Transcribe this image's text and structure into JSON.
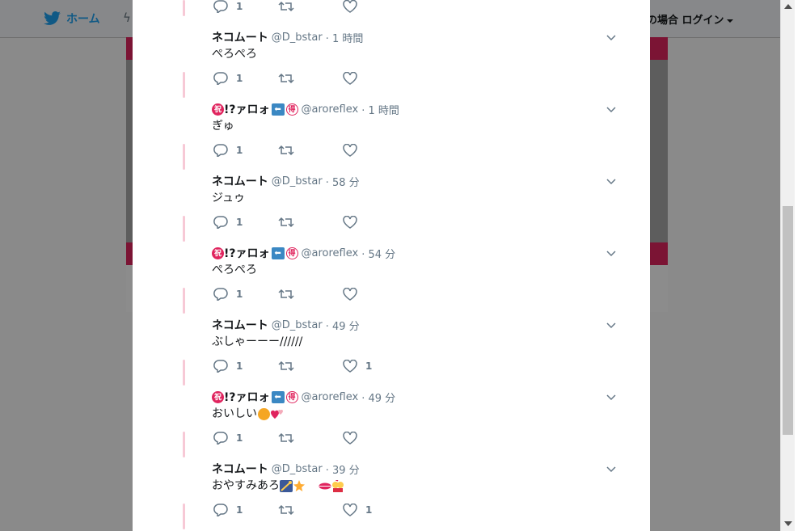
{
  "nav": {
    "home_label": "ホーム",
    "login_prefix": "の場合",
    "login_label": "ログイン"
  },
  "colors": {
    "accent": "#1da1f2",
    "brand_pink": "#e0245e",
    "thread_line": "#f7c9d6"
  },
  "top_actions": {
    "reply_count": "1"
  },
  "tweets": [
    {
      "name": "ネコムート",
      "handle": "@D_bstar",
      "time": "· 1 時間",
      "text": "ぺろぺろ",
      "reply_count": "1",
      "like_count": ""
    },
    {
      "name": "!?ァロォ",
      "handle": "@aroreflex",
      "time": "· 1 時間",
      "text": "ぎゅ",
      "reply_count": "1",
      "like_count": ""
    },
    {
      "name": "ネコムート",
      "handle": "@D_bstar",
      "time": "· 58 分",
      "text": "ジュゥ",
      "reply_count": "1",
      "like_count": ""
    },
    {
      "name": "!?ァロォ",
      "handle": "@aroreflex",
      "time": "· 54 分",
      "text": "ぺろぺろ",
      "reply_count": "1",
      "like_count": ""
    },
    {
      "name": "ネコムート",
      "handle": "@D_bstar",
      "time": "· 49 分",
      "text": "ぶしゃーーー//////",
      "reply_count": "1",
      "like_count": "1"
    },
    {
      "name": "!?ァロォ",
      "handle": "@aroreflex",
      "time": "· 49 分",
      "text": "おいしい",
      "reply_count": "1",
      "like_count": ""
    },
    {
      "name": "ネコムート",
      "handle": "@D_bstar",
      "time": "· 39 分",
      "text": "おやすみあろ",
      "reply_count": "1",
      "like_count": "1"
    }
  ],
  "badges": {
    "left": "祝",
    "right": "得",
    "arrow": "⬅"
  }
}
